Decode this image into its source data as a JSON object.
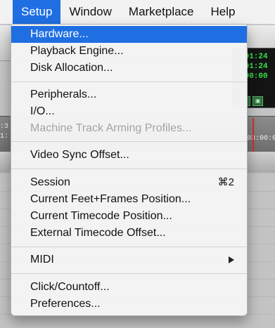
{
  "menubar": {
    "items": [
      "Setup",
      "Window",
      "Marketplace",
      "Help"
    ]
  },
  "setup_menu": {
    "group1": [
      "Hardware...",
      "Playback Engine...",
      "Disk Allocation..."
    ],
    "group2": [
      "Peripherals...",
      "I/O...",
      "Machine Track Arming Profiles..."
    ],
    "group3": [
      "Video Sync Offset..."
    ],
    "group4": [
      "Session",
      "Current Feet+Frames Position...",
      "Current Timecode Position...",
      "External Timecode Offset..."
    ],
    "session_shortcut": "⌘2",
    "group5": [
      "MIDI"
    ],
    "group6": [
      "Click/Countoff...",
      "Preferences..."
    ],
    "highlighted": "Hardware...",
    "disabled": "Machine Track Arming Profiles..."
  },
  "background": {
    "counter_lines": [
      ":01:24",
      ":01:24",
      ":00:00"
    ],
    "ruler_left_lines": [
      ":3",
      "1:"
    ],
    "ruler_right_text": "03:00:0"
  },
  "colors": {
    "highlight": "#1f6fe3",
    "menu_bg": "#f3f3f3",
    "counter_text": "#33e04a",
    "playhead": "#e02828"
  }
}
